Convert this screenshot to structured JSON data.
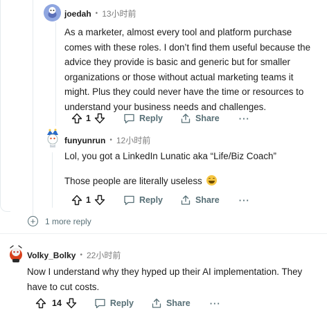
{
  "comments": [
    {
      "user": "joedah",
      "time": "13小时前",
      "text": "As a marketer, almost every tool and platform purchase comes with these roles. I don’t find them useful because the advice they provide is basic and generic but for smaller organizations or those without actual marketing teams it might. Plus they could never have the time or resources to understand your business needs and challenges.",
      "votes": "1",
      "reply_label": "Reply",
      "share_label": "Share",
      "more": "···"
    },
    {
      "user": "funyunrun",
      "time": "12小时前",
      "paragraphs": [
        "Lol, you got a LinkedIn Lunatic aka “Life/Biz Coach”",
        "Those people are literally useless"
      ],
      "emoji": "grinning-emoji",
      "votes": "1",
      "reply_label": "Reply",
      "share_label": "Share",
      "more": "···"
    },
    {
      "user": "Volky_Bolky",
      "time": "22小时前",
      "text": "Now I understand why they hyped up their AI implementation. They have to cut costs.",
      "votes": "14",
      "reply_label": "Reply",
      "share_label": "Share",
      "more": "···"
    }
  ],
  "more_replies": "1 more reply",
  "icons": {
    "upvote": "upvote-arrow-icon",
    "downvote": "downvote-arrow-icon",
    "reply": "speech-bubble-icon",
    "share": "share-icon",
    "expand": "plus-circle-icon"
  },
  "colors": {
    "action_gray": "#576f76",
    "thread_line": "#e5ebee",
    "text": "#1c1c1c"
  }
}
